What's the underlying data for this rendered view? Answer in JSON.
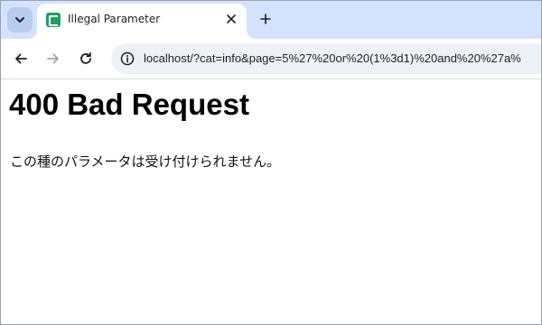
{
  "browser": {
    "tab": {
      "title": "Illegal Parameter",
      "favicon": "page-favicon-icon"
    },
    "address_bar": {
      "url": "localhost/?cat=info&page=5%27%20or%20(1%3d1)%20and%20%27a%"
    }
  },
  "page": {
    "heading": "400 Bad Request",
    "message": "この種のパラメータは受け付けられません。"
  },
  "colors": {
    "tabstrip": "#d3e3fd",
    "favicon": "#1aa260",
    "omnibox": "#eef2f8"
  }
}
